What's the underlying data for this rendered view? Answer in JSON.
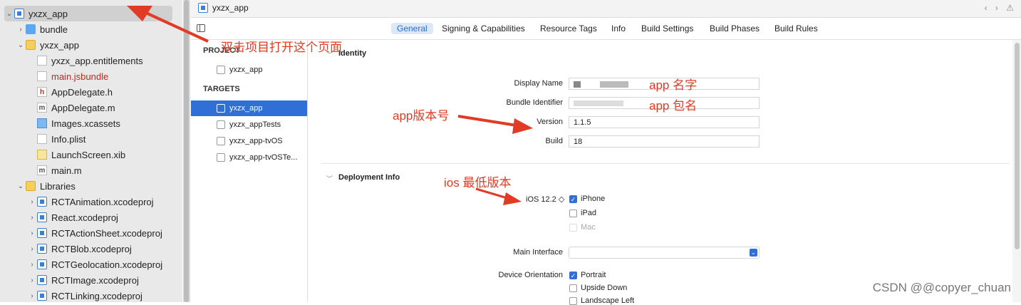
{
  "navigator": {
    "items": [
      {
        "label": "yxzx_app",
        "depth": 0,
        "disclosure": "open",
        "icon": "project-icon"
      },
      {
        "label": "bundle",
        "depth": 1,
        "disclosure": "closed",
        "icon": "folder-blue-icon"
      },
      {
        "label": "yxzx_app",
        "depth": 1,
        "disclosure": "open",
        "icon": "folder-yellow-icon"
      },
      {
        "label": "yxzx_app.entitlements",
        "depth": 2,
        "icon": "file-icon"
      },
      {
        "label": "main.jsbundle",
        "depth": 2,
        "icon": "file-icon",
        "color": "red"
      },
      {
        "label": "AppDelegate.h",
        "depth": 2,
        "icon": "header-file-icon",
        "glyph": "h"
      },
      {
        "label": "AppDelegate.m",
        "depth": 2,
        "icon": "objc-file-icon",
        "glyph": "m"
      },
      {
        "label": "Images.xcassets",
        "depth": 2,
        "icon": "assets-icon"
      },
      {
        "label": "Info.plist",
        "depth": 2,
        "icon": "plist-icon"
      },
      {
        "label": "LaunchScreen.xib",
        "depth": 2,
        "icon": "xib-icon"
      },
      {
        "label": "main.m",
        "depth": 2,
        "icon": "objc-file-icon",
        "glyph": "m"
      },
      {
        "label": "Libraries",
        "depth": 1,
        "disclosure": "open",
        "icon": "folder-yellow-icon"
      },
      {
        "label": "RCTAnimation.xcodeproj",
        "depth": 2,
        "disclosure": "closed",
        "icon": "project-icon"
      },
      {
        "label": "React.xcodeproj",
        "depth": 2,
        "disclosure": "closed",
        "icon": "project-icon"
      },
      {
        "label": "RCTActionSheet.xcodeproj",
        "depth": 2,
        "disclosure": "closed",
        "icon": "project-icon"
      },
      {
        "label": "RCTBlob.xcodeproj",
        "depth": 2,
        "disclosure": "closed",
        "icon": "project-icon"
      },
      {
        "label": "RCTGeolocation.xcodeproj",
        "depth": 2,
        "disclosure": "closed",
        "icon": "project-icon"
      },
      {
        "label": "RCTImage.xcodeproj",
        "depth": 2,
        "disclosure": "closed",
        "icon": "project-icon"
      },
      {
        "label": "RCTLinking.xcodeproj",
        "depth": 2,
        "disclosure": "closed",
        "icon": "project-icon"
      }
    ]
  },
  "tab": {
    "title": "yxzx_app",
    "arrows": "‹ › ⚠"
  },
  "segments": [
    "General",
    "Signing & Capabilities",
    "Resource Tags",
    "Info",
    "Build Settings",
    "Build Phases",
    "Build Rules"
  ],
  "targets": {
    "project_header": "PROJECT",
    "project": "yxzx_app",
    "targets_header": "TARGETS",
    "items": [
      "yxzx_app",
      "yxzx_appTests",
      "yxzx_app-tvOS",
      "yxzx_app-tvOSTe..."
    ]
  },
  "identity": {
    "header": "Identity",
    "display_name_label": "Display Name",
    "bundle_identifier_label": "Bundle Identifier",
    "version_label": "Version",
    "version_value": "1.1.5",
    "build_label": "Build",
    "build_value": "18"
  },
  "deployment": {
    "header": "Deployment Info",
    "ios_version": "iOS 12.2 ◇",
    "devices": [
      {
        "label": "iPhone",
        "checked": true
      },
      {
        "label": "iPad",
        "checked": false
      },
      {
        "label": "Mac",
        "checked": false,
        "disabled": true
      }
    ],
    "main_interface_label": "Main Interface",
    "device_orientation_label": "Device Orientation",
    "orientations": [
      {
        "label": "Portrait",
        "checked": true
      },
      {
        "label": "Upside Down",
        "checked": false
      },
      {
        "label": "Landscape Left",
        "checked": false
      }
    ]
  },
  "annotations": {
    "double_click": "双击项目打开这个页面",
    "app_name": "app 名字",
    "app_package": "app 包名",
    "app_version": "app版本号",
    "ios_min": "ios 最低版本"
  },
  "watermark": "CSDN @@copyer_chuan",
  "colors": {
    "accent": "#2f6fd6",
    "annotation": "#e23b25",
    "navigator_bg": "#e9e9e9"
  }
}
